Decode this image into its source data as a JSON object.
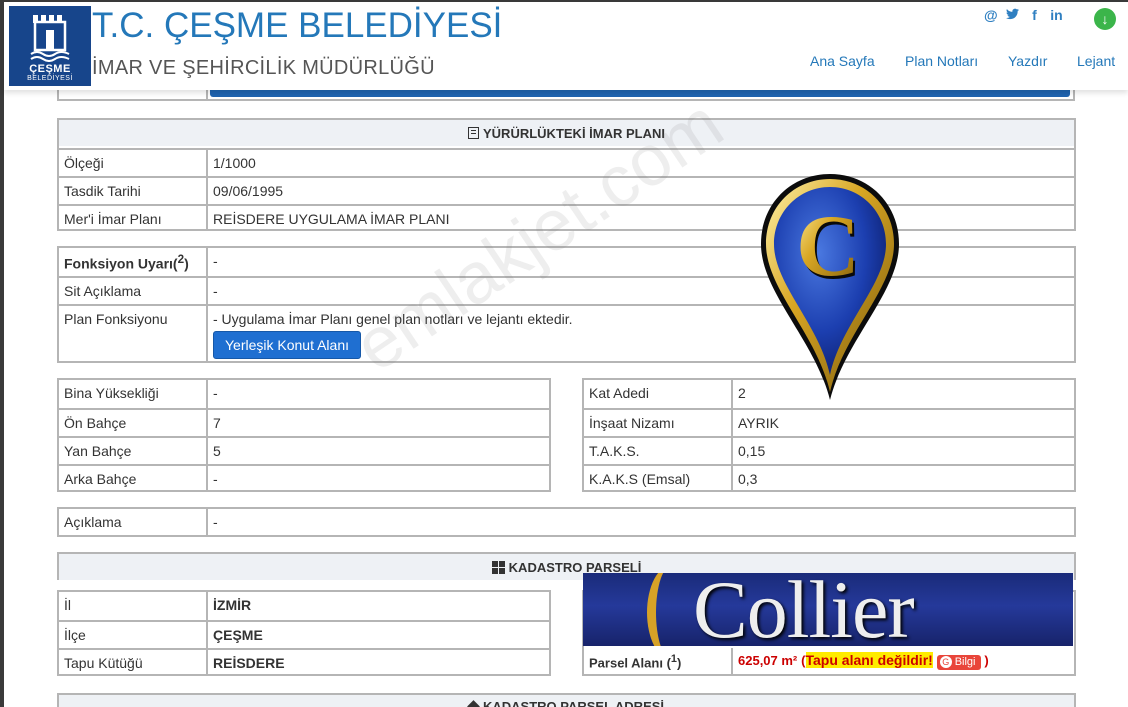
{
  "header": {
    "logo_line1": "ÇEŞME",
    "logo_line2": "BELEDİYESİ",
    "title": "T.C. ÇEŞME BELEDİYESİ",
    "subtitle": "İMAR VE ŞEHİRCİLİK MÜDÜRLÜĞÜ",
    "social_icons": [
      "at-icon",
      "twitter-icon",
      "facebook-icon",
      "linkedin-icon"
    ],
    "download_icon": "download-icon",
    "nav": [
      "Ana Sayfa",
      "Plan Notları",
      "Yazdır",
      "Lejant"
    ]
  },
  "imar_plani": {
    "header": "YÜRÜRLÜKTEKİ İMAR PLANI",
    "rows": [
      {
        "label": "Ölçeği",
        "value": "1/1000"
      },
      {
        "label": "Tasdik Tarihi",
        "value": "09/06/1995"
      },
      {
        "label": "Mer'i İmar Planı",
        "value": "REİSDERE UYGULAMA İMAR PLANI"
      }
    ]
  },
  "fonksiyon": {
    "uyari_label": "Fonksiyon Uyarı",
    "uyari_sup": "2",
    "uyari_value": "-",
    "sit_label": "Sit Açıklama",
    "sit_value": "-",
    "plan_label": "Plan Fonksiyonu",
    "plan_note": "- Uygulama İmar Planı genel plan notları ve lejantı ektedir.",
    "plan_button": "Yerleşik Konut Alanı"
  },
  "bina": [
    {
      "label": "Bina Yüksekliği",
      "value": "-"
    },
    {
      "label": "Ön Bahçe",
      "value": "7"
    },
    {
      "label": "Yan Bahçe",
      "value": "5"
    },
    {
      "label": "Arka Bahçe",
      "value": "-"
    }
  ],
  "kat": [
    {
      "label": "Kat Adedi",
      "value": "2"
    },
    {
      "label": "İnşaat Nizamı",
      "value": "AYRIK"
    },
    {
      "label": "T.A.K.S.",
      "value": "0,15"
    },
    {
      "label": "K.A.K.S (Emsal)",
      "value": "0,3"
    }
  ],
  "aciklama": {
    "label": "Açıklama",
    "value": "-"
  },
  "kadastro": {
    "header": "KADASTRO PARSELİ",
    "rows": [
      {
        "label": "İl",
        "value": "İZMİR"
      },
      {
        "label": "İlçe",
        "value": "ÇEŞME"
      },
      {
        "label": "Tapu Kütüğü",
        "value": "REİSDERE"
      }
    ],
    "parsel_label": "Parsel Alanı",
    "parsel_sup": "1",
    "parsel_value": "625,07 m²",
    "tapu_warning": "Tapu alanı değildir!",
    "bilgi": "Bilgi"
  },
  "adres_header": "KADASTRO PARSEL ADRESİ",
  "overlays": {
    "watermark": "emlakjet.com",
    "pin_letter": "C",
    "collier_logo": "Collier"
  }
}
